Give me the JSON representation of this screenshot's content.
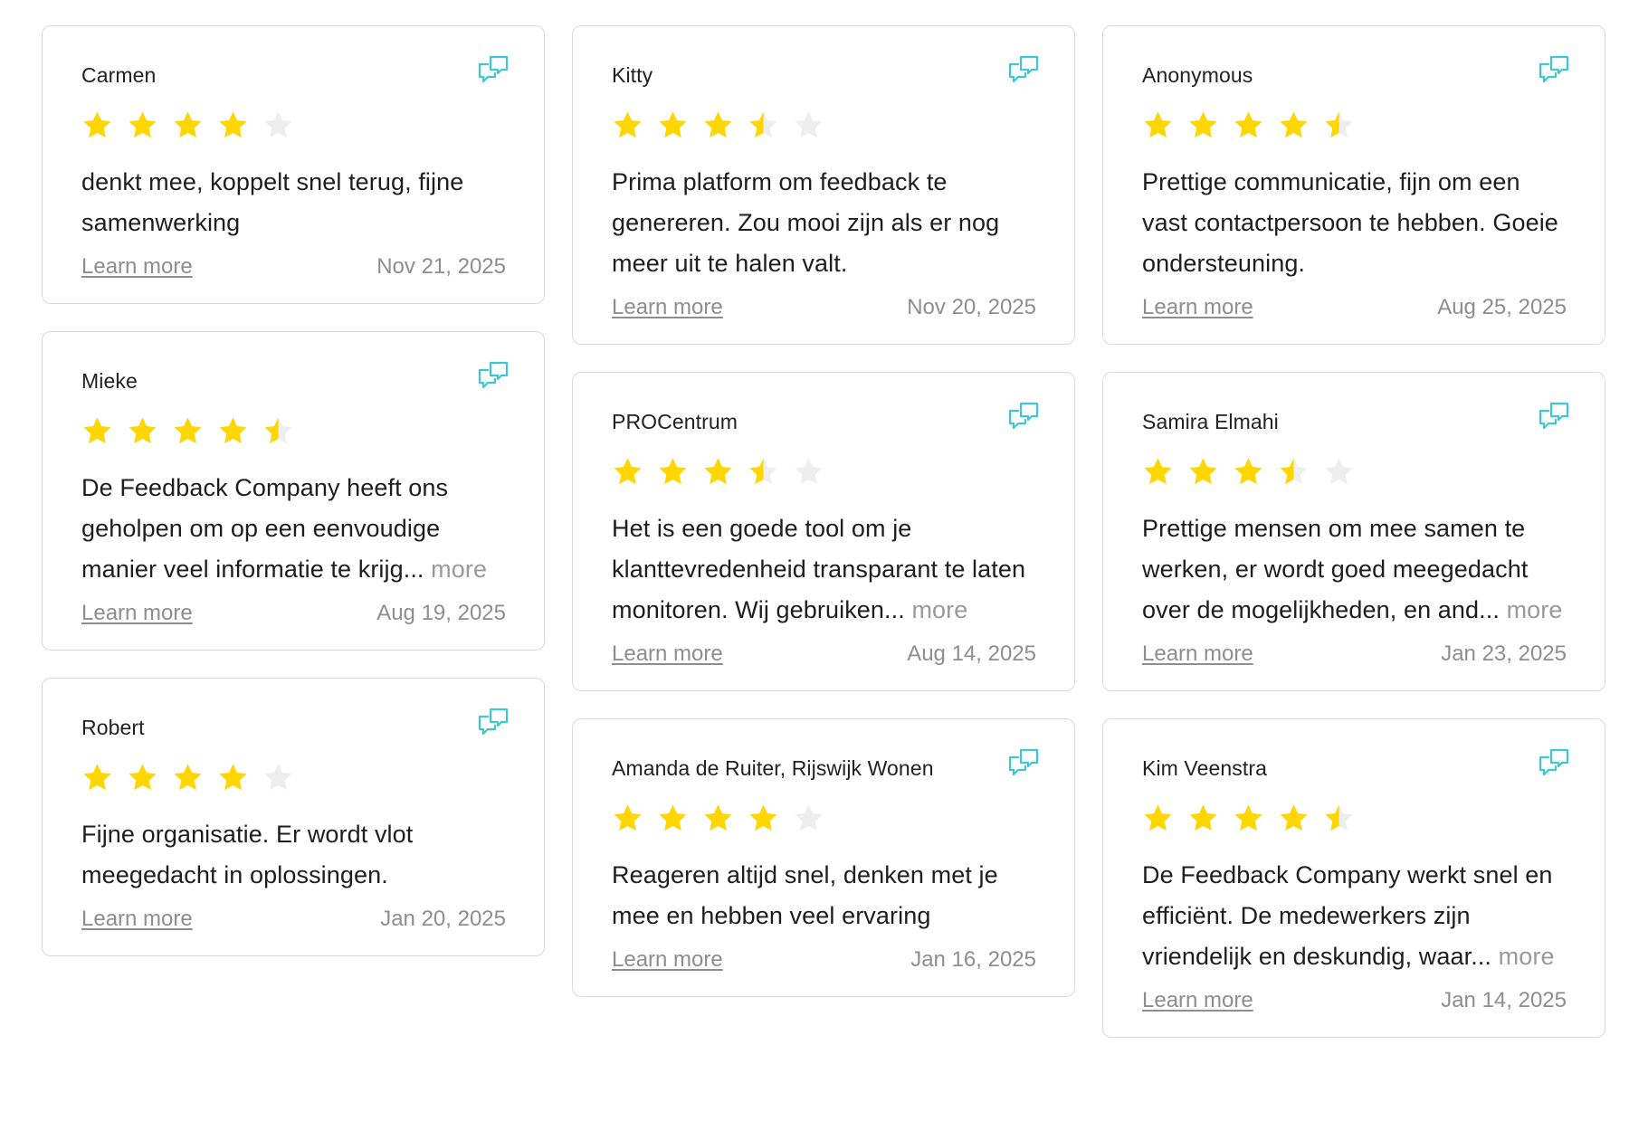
{
  "colors": {
    "star_filled": "#FFD600",
    "star_empty": "#EEEEEE",
    "icon_accent": "#3EC7D4",
    "muted_text": "#8E8E8E",
    "border": "#DADADA"
  },
  "icons": {
    "share": "share-review-icon",
    "star": "star-icon"
  },
  "columns": [
    [
      {
        "reviewer": "Carmen",
        "rating": 4,
        "text": "denkt mee, koppelt snel terug, fijne samenwerking",
        "more_label": "",
        "link_label": "Learn more",
        "date": "Nov 21, 2025"
      },
      {
        "reviewer": "Mieke",
        "rating": 4.5,
        "text": "De Feedback Company heeft ons geholpen om op een eenvoudige manier veel informatie te krijg...",
        "more_label": "more",
        "link_label": "Learn more",
        "date": "Aug 19, 2025"
      },
      {
        "reviewer": "Robert",
        "rating": 4,
        "text": "Fijne organisatie. Er wordt vlot meegedacht in oplossingen.",
        "more_label": "",
        "link_label": "Learn more",
        "date": "Jan 20, 2025"
      }
    ],
    [
      {
        "reviewer": "Kitty",
        "rating": 3.5,
        "text": "Prima platform om feedback te genereren. Zou mooi zijn als er nog meer uit te halen valt.",
        "more_label": "",
        "link_label": "Learn more",
        "date": "Nov 20, 2025"
      },
      {
        "reviewer": "PROCentrum",
        "rating": 3.5,
        "text": "Het is een goede tool om je klanttevredenheid transparant te laten monitoren. Wij gebruiken...",
        "more_label": "more",
        "link_label": "Learn more",
        "date": "Aug 14, 2025"
      },
      {
        "reviewer": "Amanda de Ruiter, Rijswijk Wonen",
        "rating": 4,
        "text": "Reageren altijd snel, denken met je mee en hebben veel ervaring",
        "more_label": "",
        "link_label": "Learn more",
        "date": "Jan 16, 2025"
      }
    ],
    [
      {
        "reviewer": "Anonymous",
        "rating": 4.5,
        "text": "Prettige communicatie, fijn om een vast contactpersoon te hebben. Goeie ondersteuning.",
        "more_label": "",
        "link_label": "Learn more",
        "date": "Aug 25, 2025"
      },
      {
        "reviewer": "Samira Elmahi",
        "rating": 3.5,
        "text": "Prettige mensen om mee samen te werken, er wordt goed meegedacht over de mogelijkheden, en and...",
        "more_label": "more",
        "link_label": "Learn more",
        "date": "Jan 23, 2025"
      },
      {
        "reviewer": "Kim Veenstra",
        "rating": 4.5,
        "text": "De Feedback Company werkt snel en efficiënt. De medewerkers zijn vriendelijk en deskundig, waar...",
        "more_label": "more",
        "link_label": "Learn more",
        "date": "Jan 14, 2025"
      }
    ]
  ]
}
